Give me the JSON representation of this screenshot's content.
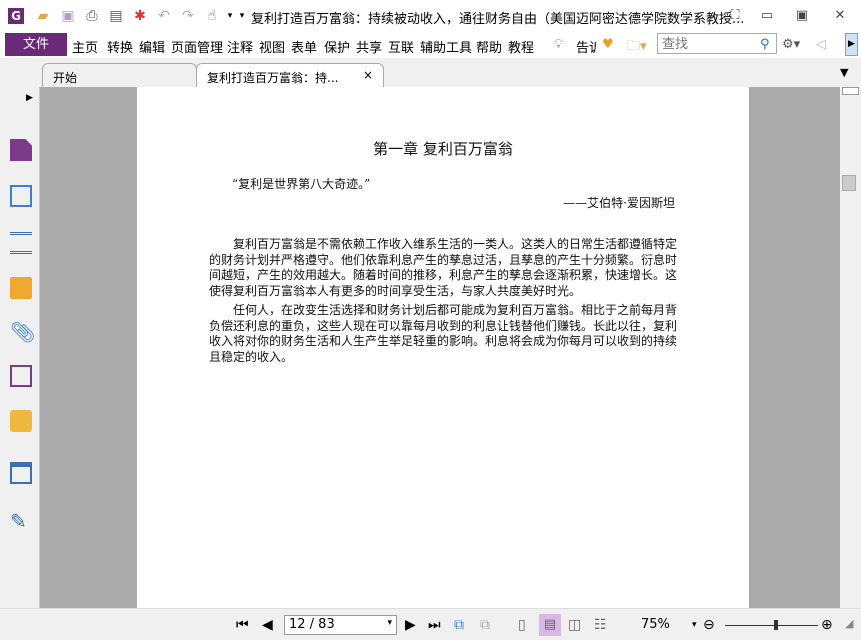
{
  "titlebar": {
    "title": "复利打造百万富翁：持续被动收入，通往财务自由（美国迈阿密达德学院数学系教授..."
  },
  "menu": {
    "file": "文件",
    "items": [
      "主页",
      "转换",
      "编辑",
      "页面管理",
      "注释",
      "视图",
      "表单",
      "保护",
      "共享",
      "互联",
      "辅助工具",
      "帮助",
      "教程"
    ],
    "tell": "告诉",
    "search_placeholder": "查找"
  },
  "tabs": [
    {
      "label": "开始"
    },
    {
      "label": "复利打造百万富翁：持..."
    }
  ],
  "tab_close": "×",
  "document": {
    "chapter_title": "第一章 复利百万富翁",
    "quote": "“复利是世界第八大奇迹。”",
    "attribution": "——艾伯特·爱因斯坦",
    "paragraphs": [
      "复利百万富翁是不需依赖工作收入维系生活的一类人。这类人的日常生活都遵循特定的财务计划并严格遵守。他们依靠利息产生的孳息过活，且孳息的产生十分频繁。衍息时间越短，产生的效用越大。随着时间的推移，利息产生的孳息会逐渐积累，快速增长。这使得复利百万富翁本人有更多的时间享受生活，与家人共度美好时光。",
      "任何人，在改变生活选择和财务计划后都可能成为复利百万富翁。相比于之前每月背负偿还利息的重负，这些人现在可以靠每月收到的利息让钱替他们赚钱。长此以往，复利收入将对你的财务生活和人生产生举足轻重的影响。利息将会成为你每月可以收到的持续且稳定的收入。"
    ]
  },
  "status": {
    "page": "12 / 83",
    "zoom": "75%",
    "zoom_fraction": 0.55
  },
  "colors": {
    "brand": "#6b2a77",
    "active_view": "#d9b8e6"
  }
}
